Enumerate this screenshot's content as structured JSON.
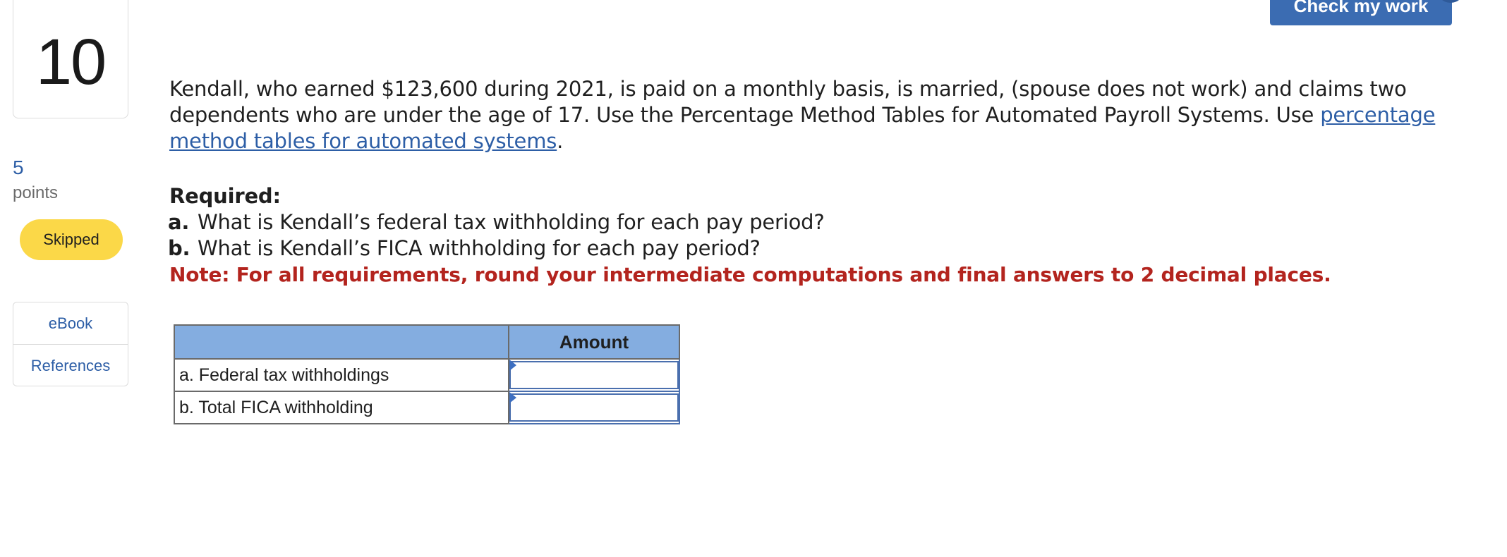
{
  "header": {
    "check_button_label": "Check my work"
  },
  "sidebar": {
    "question_number": "10",
    "points_value": "5",
    "points_label": "points",
    "status": "Skipped",
    "resources": [
      {
        "label": "eBook"
      },
      {
        "label": "References"
      }
    ]
  },
  "question": {
    "text_before_link": "Kendall, who earned $123,600 during 2021, is paid on a monthly basis, is married, (spouse does not work) and claims two dependents who are under the age of 17. Use the Percentage Method Tables for Automated Payroll Systems. Use ",
    "link_text": "percentage method tables for automated systems",
    "text_after_link": "."
  },
  "requirements": {
    "title": "Required:",
    "items": [
      {
        "letter": "a.",
        "text": "What is Kendall’s federal tax withholding for each pay period?"
      },
      {
        "letter": "b.",
        "text": "What is Kendall’s FICA withholding for each pay period?"
      }
    ],
    "note": "Note: For all requirements, round your intermediate computations and final answers to 2 decimal places."
  },
  "answer_table": {
    "header_blank": "",
    "header_amount": "Amount",
    "rows": [
      {
        "label": "a. Federal tax withholdings",
        "value": ""
      },
      {
        "label": "b. Total FICA withholding",
        "value": ""
      }
    ]
  },
  "colors": {
    "primary": "#3b6cb2",
    "link": "#2d5ea6",
    "skipped_badge": "#fbd848",
    "note_red": "#b3241e",
    "table_header": "#84ade0"
  }
}
